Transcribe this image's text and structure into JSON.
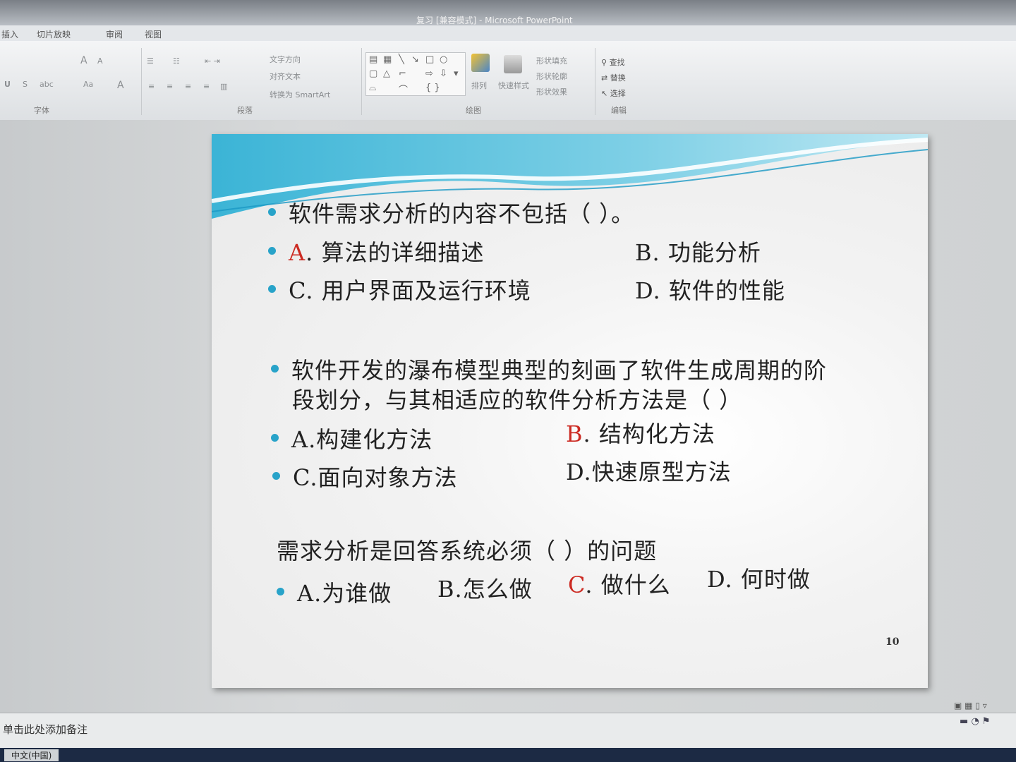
{
  "window": {
    "title": "复习 [兼容模式] - Microsoft PowerPoint"
  },
  "tabs": [
    "插入",
    "切片放映",
    "审阅",
    "视图"
  ],
  "ribbon": {
    "paragraph_tools": [
      "文字方向",
      "对齐文本",
      "转换为 SmartArt"
    ],
    "drawing_tools": [
      "排列",
      "快速样式",
      "形状填充",
      "形状轮廓",
      "形状效果"
    ],
    "editing_tools": [
      "查找",
      "替换",
      "选择"
    ],
    "groups": [
      "字体",
      "段落",
      "绘图",
      "编辑"
    ]
  },
  "slide": {
    "q1": {
      "question": "软件需求分析的内容不包括（ ）。",
      "a_letter": "A",
      "a_text": ". 算法的详细描述",
      "b": "B. 功能分析",
      "c": "C. 用户界面及运行环境",
      "d": "D. 软件的性能"
    },
    "q2": {
      "question_line1": "软件开发的瀑布模型典型的刻画了软件生成周期的阶",
      "question_line2": "段划分，与其相适应的软件分析方法是（ ）",
      "a": "A.构建化方法",
      "b_letter": "B",
      "b_text": ". 结构化方法",
      "c": "C.面向对象方法",
      "d": "D.快速原型方法"
    },
    "q3": {
      "question": "需求分析是回答系统必须（ ）的问题",
      "a": "A.为谁做",
      "b": "B.怎么做",
      "c_letter": "C",
      "c_text": ". 做什么",
      "d": "D. 何时做"
    },
    "page_number": "10"
  },
  "notes": {
    "placeholder": "单击此处添加备注"
  },
  "status": {
    "language": "中文(中国)"
  },
  "colors": {
    "accent": "#28a3c9",
    "answer_red": "#cc2a22"
  }
}
